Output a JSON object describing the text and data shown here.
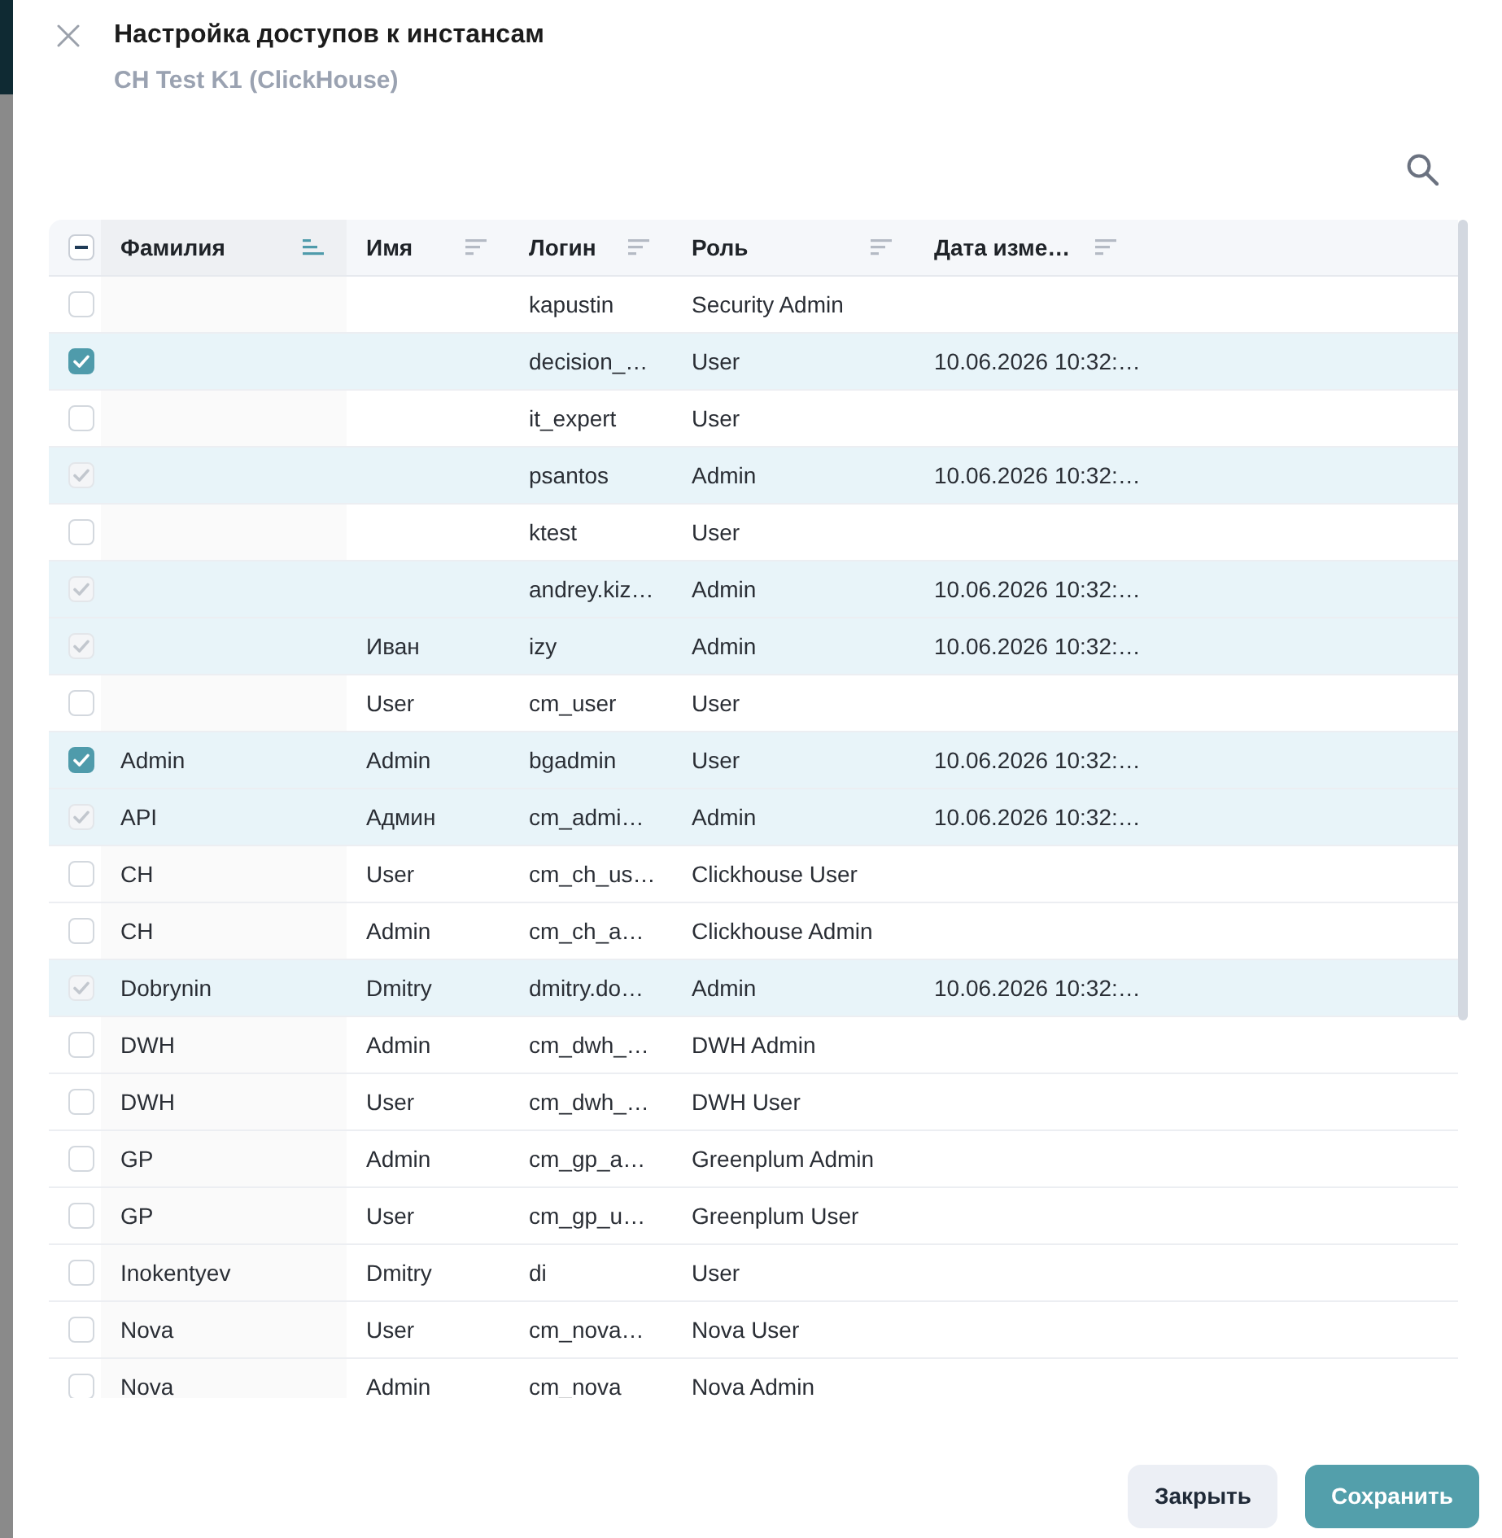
{
  "dialog": {
    "title": "Настройка доступов к инстансам",
    "subtitle": "CH Test K1 (ClickHouse)"
  },
  "table": {
    "header_checkbox": {
      "indeterminate": true
    },
    "columns": [
      {
        "label": "Фамилия",
        "sorted": true
      },
      {
        "label": "Имя",
        "sorted": false
      },
      {
        "label": "Логин",
        "sorted": false
      },
      {
        "label": "Роль",
        "sorted": false
      },
      {
        "label": "Дата изме…",
        "sorted": false
      }
    ],
    "rows": [
      {
        "login": "kapustin",
        "role": "Security Admin",
        "checked": false,
        "disabled": false
      },
      {
        "login": "decision_…",
        "role": "User",
        "modified": "10.06.2026 10:32:…",
        "checked": true,
        "disabled": false
      },
      {
        "login": "it_expert",
        "role": "User",
        "checked": false,
        "disabled": false
      },
      {
        "login": "psantos",
        "role": "Admin",
        "modified": "10.06.2026 10:32:…",
        "checked": true,
        "disabled": true
      },
      {
        "login": "ktest",
        "role": "User",
        "checked": false,
        "disabled": false
      },
      {
        "login": "andrey.kiz…",
        "role": "Admin",
        "modified": "10.06.2026 10:32:…",
        "checked": true,
        "disabled": true
      },
      {
        "name": "Иван",
        "login": "izy",
        "role": "Admin",
        "modified": "10.06.2026 10:32:…",
        "checked": true,
        "disabled": true
      },
      {
        "name": "User",
        "login": "cm_user",
        "role": "User",
        "checked": false,
        "disabled": false
      },
      {
        "surname": "Admin",
        "name": "Admin",
        "login": "bgadmin",
        "role": "User",
        "modified": "10.06.2026 10:32:…",
        "checked": true,
        "disabled": false
      },
      {
        "surname": "API",
        "name": "Админ",
        "login": "cm_admi…",
        "role": "Admin",
        "modified": "10.06.2026 10:32:…",
        "checked": true,
        "disabled": true
      },
      {
        "surname": "CH",
        "name": "User",
        "login": "cm_ch_us…",
        "role": "Clickhouse User",
        "checked": false,
        "disabled": false
      },
      {
        "surname": "CH",
        "name": "Admin",
        "login": "cm_ch_a…",
        "role": "Clickhouse Admin",
        "checked": false,
        "disabled": false
      },
      {
        "surname": "Dobrynin",
        "name": "Dmitry",
        "login": "dmitry.do…",
        "role": "Admin",
        "modified": "10.06.2026 10:32:…",
        "checked": true,
        "disabled": true
      },
      {
        "surname": "DWH",
        "name": "Admin",
        "login": "cm_dwh_…",
        "role": "DWH Admin",
        "checked": false,
        "disabled": false
      },
      {
        "surname": "DWH",
        "name": "User",
        "login": "cm_dwh_…",
        "role": "DWH User",
        "checked": false,
        "disabled": false
      },
      {
        "surname": "GP",
        "name": "Admin",
        "login": "cm_gp_a…",
        "role": "Greenplum Admin",
        "checked": false,
        "disabled": false
      },
      {
        "surname": "GP",
        "name": "User",
        "login": "cm_gp_u…",
        "role": "Greenplum User",
        "checked": false,
        "disabled": false
      },
      {
        "surname": "Inokentyev",
        "name": "Dmitry",
        "login": "di",
        "role": "User",
        "checked": false,
        "disabled": false
      },
      {
        "surname": "Nova",
        "name": "User",
        "login": "cm_nova…",
        "role": "Nova User",
        "checked": false,
        "disabled": false
      },
      {
        "surname": "Nova",
        "name": "Admin",
        "login": "cm_nova",
        "role": "Nova Admin",
        "checked": false,
        "disabled": false
      }
    ]
  },
  "buttons": [
    {
      "label": "Закрыть",
      "kind": "secondary"
    },
    {
      "label": "Сохранить",
      "kind": "primary"
    }
  ]
}
